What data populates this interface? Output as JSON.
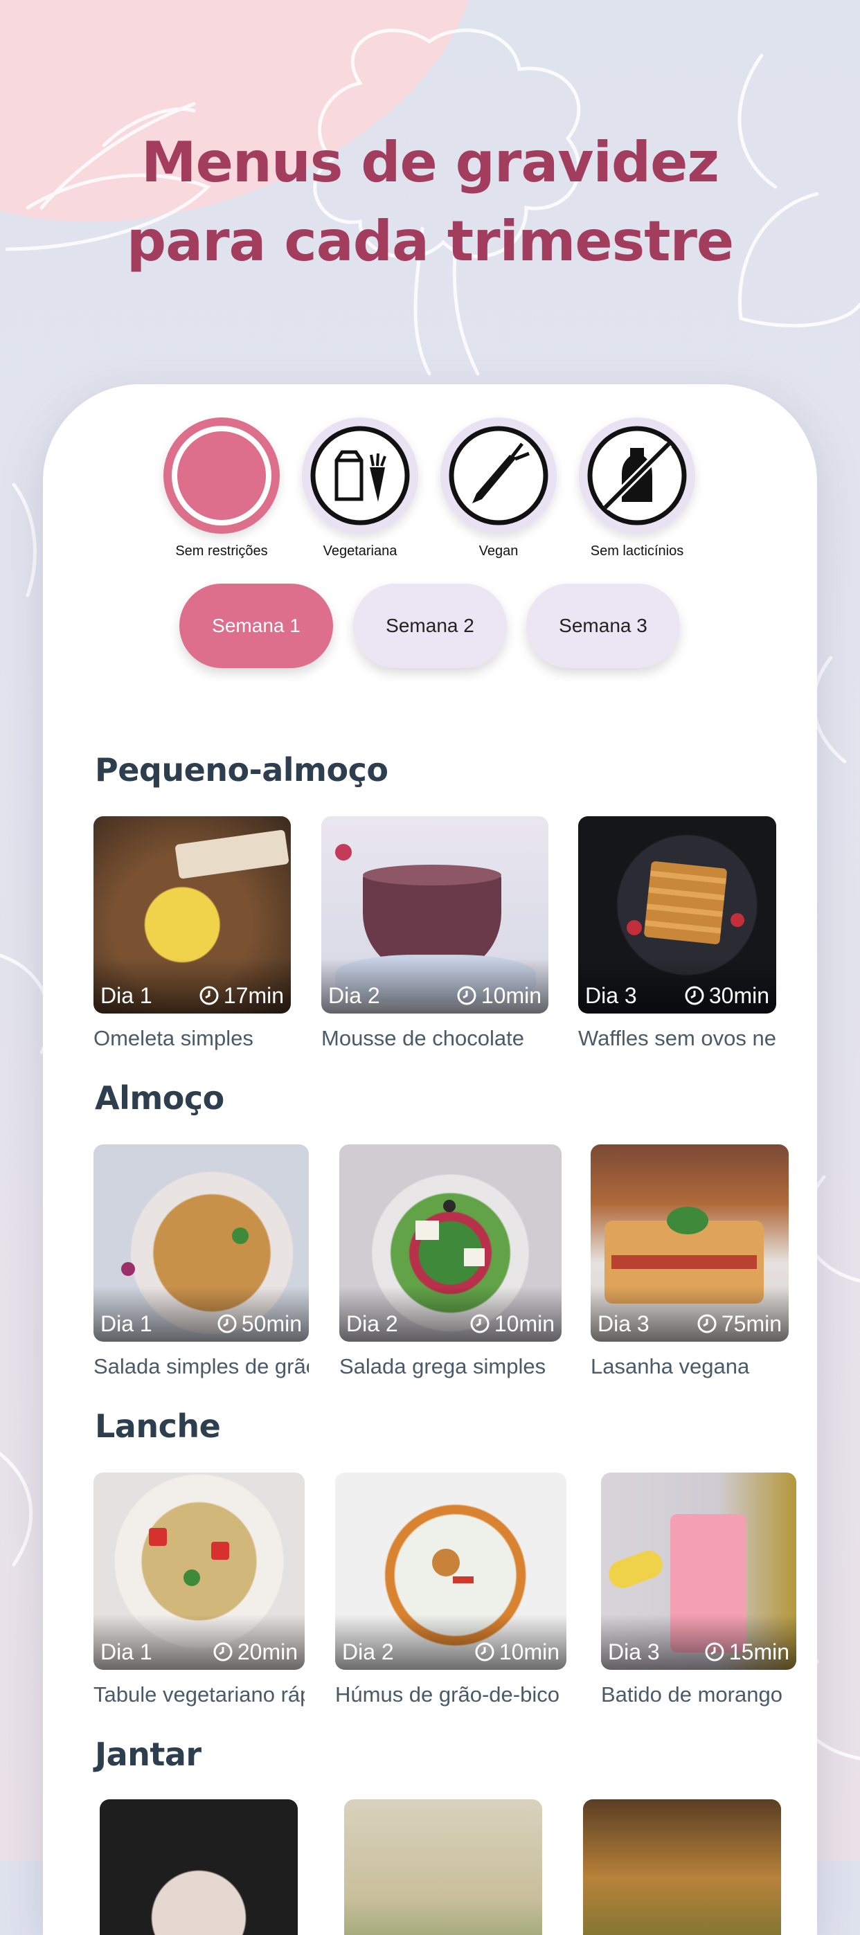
{
  "headline": {
    "line1": "Menus de gravidez",
    "line2": "para cada trimestre"
  },
  "filters": [
    {
      "label": "Sem restrições",
      "icon": "ring-icon",
      "active": true
    },
    {
      "label": "Vegetariana",
      "icon": "milk-carrot-icon",
      "active": false
    },
    {
      "label": "Vegan",
      "icon": "carrot-icon",
      "active": false
    },
    {
      "label": "Sem lacticínios",
      "icon": "no-milk-icon",
      "active": false
    }
  ],
  "weeks": [
    {
      "label": "Semana 1",
      "active": true
    },
    {
      "label": "Semana 2",
      "active": false
    },
    {
      "label": "Semana 3",
      "active": false
    }
  ],
  "sections": [
    {
      "title": "Pequeno-almoço",
      "cards": [
        {
          "day": "Dia 1",
          "time": "17min",
          "name": "Omeleta simples"
        },
        {
          "day": "Dia 2",
          "time": "10min",
          "name": "Mousse de chocolate"
        },
        {
          "day": "Dia 3",
          "time": "30min",
          "name": "Waffles sem ovos nem"
        }
      ]
    },
    {
      "title": "Almoço",
      "cards": [
        {
          "day": "Dia 1",
          "time": "50min",
          "name": "Salada simples de grão"
        },
        {
          "day": "Dia 2",
          "time": "10min",
          "name": "Salada grega simples"
        },
        {
          "day": "Dia 3",
          "time": "75min",
          "name": "Lasanha vegana"
        }
      ]
    },
    {
      "title": "Lanche",
      "cards": [
        {
          "day": "Dia 1",
          "time": "20min",
          "name": "Tabule vegetariano rápido"
        },
        {
          "day": "Dia 2",
          "time": "10min",
          "name": "Húmus de grão-de-bico"
        },
        {
          "day": "Dia 3",
          "time": "15min",
          "name": "Batido de morango"
        }
      ]
    },
    {
      "title": "Jantar",
      "cards": []
    }
  ],
  "colors": {
    "accent": "#dd6e8c",
    "headline": "#a23d5e",
    "section_title": "#2d3e4f",
    "chip_inactive": "#ebe6f3"
  }
}
